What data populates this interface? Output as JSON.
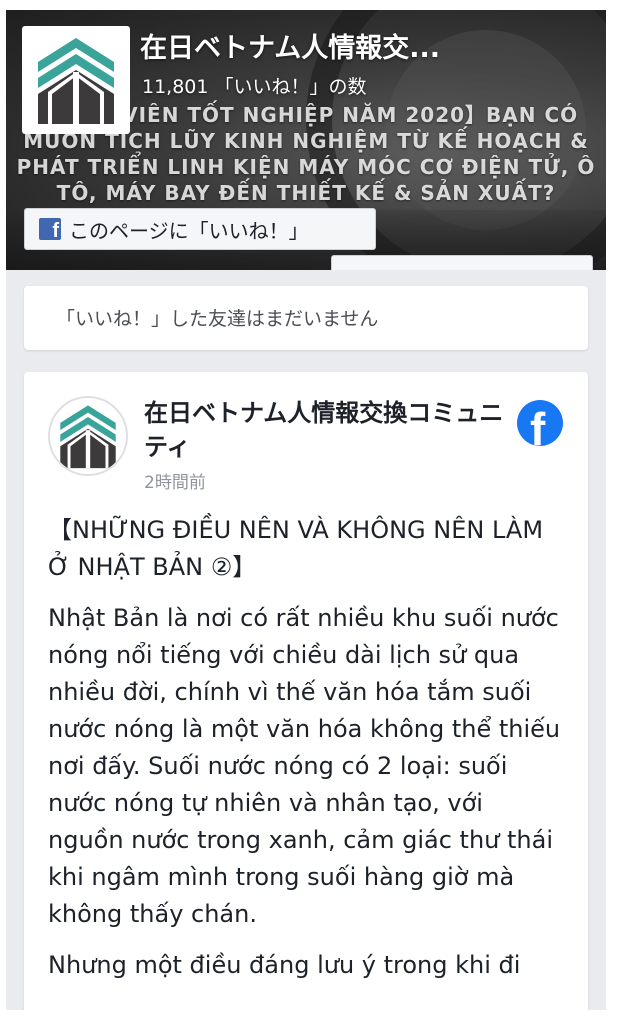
{
  "page": {
    "name": "在日ベトナム人情報交...",
    "like_count": "11,801 「いいね！」の数",
    "cover_text": "【SINH VIÊN TỐT NGHIỆP NĂM 2020】BẠN CÓ MUỐN TÍCH LŨY KINH NGHIỆM TỪ KẾ HOẠCH & PHÁT TRIỂN LINH KIỆN MÁY MÓC CƠ ĐIỆN TỬ, Ô TÔ, MÁY BAY ĐẾN THIẾT KẾ & SẢN XUẤT?",
    "like_page_button": "このページに「いいね！」",
    "icons": {
      "button_icon": "facebook-square-icon",
      "logo": "page-logo-icon"
    }
  },
  "friends_notice": "「いいね！」した友達はまだいません",
  "post": {
    "author": "在日ベトナム人情報交換コミュニティ",
    "timestamp": "2時間前",
    "title": "【NHỮNG ĐIỀU NÊN VÀ KHÔNG NÊN LÀM Ở NHẬT BẢN ②】",
    "paragraphs": [
      "Nhật Bản là nơi có rất nhiều khu suối nước nóng nổi tiếng với chiều dài lịch sử qua nhiều đời, chính vì thế văn hóa tắm suối nước nóng là một văn hóa không thể thiếu nơi đấy. Suối nước nóng có 2 loại: suối nước nóng tự nhiên và nhân tạo, với nguồn nước trong xanh, cảm giác thư thái khi ngâm mình trong suối hàng giờ mà không thấy chán.",
      "Nhưng một điều đáng lưu ý trong khi đi"
    ]
  },
  "colors": {
    "facebook_blue": "#1877f2",
    "logo_teal": "#3aa39a",
    "logo_dark": "#3d3a3b",
    "background": "#e9ebee"
  }
}
